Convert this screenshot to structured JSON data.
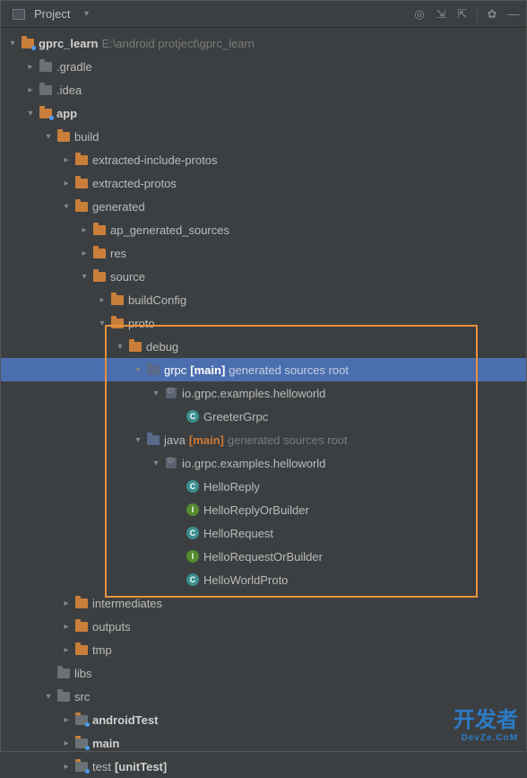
{
  "toolbar": {
    "view_label": "Project"
  },
  "root": {
    "name": "gprc_learn",
    "path": "E:\\android protject\\gprc_learn"
  },
  "tree": {
    "gradle": ".gradle",
    "idea": ".idea",
    "app": "app",
    "build": "build",
    "extracted_include": "extracted-include-protos",
    "extracted_protos": "extracted-protos",
    "generated": "generated",
    "ap_gen": "ap_generated_sources",
    "res": "res",
    "source": "source",
    "buildConfig": "buildConfig",
    "proto": "proto",
    "debug": "debug",
    "grpc": "grpc",
    "java": "java",
    "main_tag": "[main]",
    "gen_src_root": "generated sources root",
    "pkg": "io.grpc.examples.helloworld",
    "greeter_grpc": "GreeterGrpc",
    "hello_reply": "HelloReply",
    "hello_reply_builder": "HelloReplyOrBuilder",
    "hello_request": "HelloRequest",
    "hello_request_builder": "HelloRequestOrBuilder",
    "hello_world_proto": "HelloWorldProto",
    "intermediates": "intermediates",
    "outputs": "outputs",
    "tmp": "tmp",
    "libs": "libs",
    "src": "src",
    "android_test": "androidTest",
    "main": "main",
    "test": "test",
    "unit_test": "[unitTest]"
  },
  "watermark": {
    "main": "开发者",
    "sub": "DevZe.CoM"
  }
}
